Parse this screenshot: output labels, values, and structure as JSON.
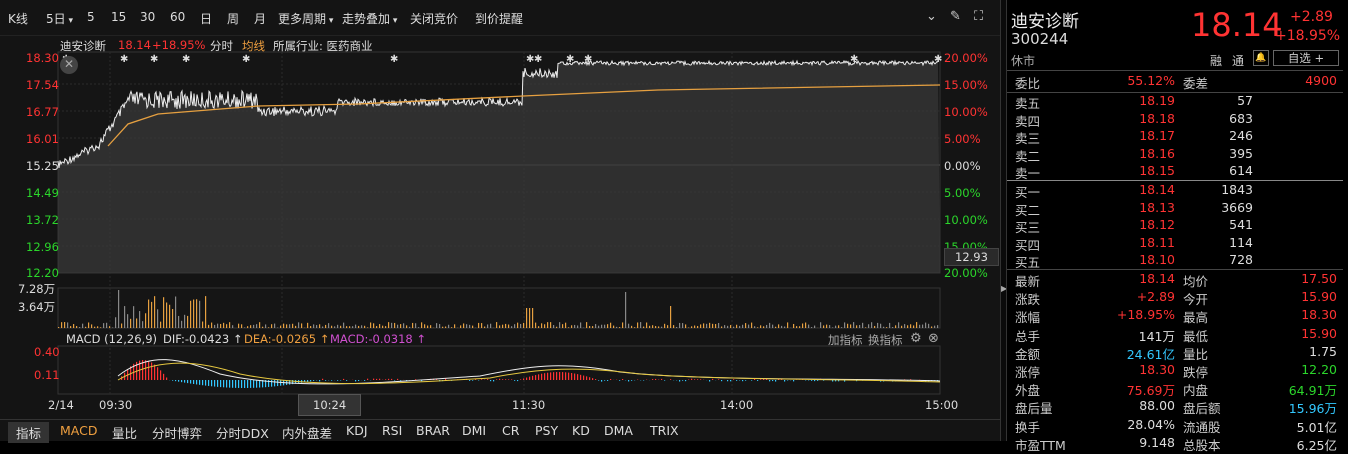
{
  "toolbar": {
    "items": [
      "K线",
      "5日",
      "5",
      "15",
      "30",
      "60",
      "日",
      "周",
      "月",
      "更多周期",
      "走势叠加",
      "关闭竞价",
      "到价提醒"
    ]
  },
  "chart_header": {
    "name": "迪安诊断",
    "price": "18.14",
    "pct": "+18.95%",
    "tab_fenshi": "分时",
    "tab_junxian": "均线",
    "industry": "所属行业: 医药商业"
  },
  "price_axis": {
    "left": [
      "18.30",
      "17.54",
      "16.77",
      "16.01",
      "15.25",
      "14.49",
      "13.72",
      "12.96",
      "12.20"
    ],
    "right": [
      "20.00%",
      "15.00%",
      "10.00%",
      "5.00%",
      "0.00%",
      "5.00%",
      "10.00%",
      "15.00%",
      "20.00%"
    ],
    "cursor_label": "12.93"
  },
  "volume_axis": {
    "labels": [
      "7.28万",
      "3.64万"
    ]
  },
  "macd": {
    "name": "MACD (12,26,9)",
    "dif": "DIF:-0.0423",
    "dea": "DEA:-0.0265",
    "macd": "MACD:-0.0318",
    "add_indicator": "加指标",
    "change_indicator": "换指标",
    "axis": [
      "0.40",
      "0.11"
    ]
  },
  "time_axis": {
    "date": "2/14",
    "labels": [
      "09:30",
      "10:24",
      "11:30",
      "14:00",
      "15:00"
    ]
  },
  "bottom_tabs": [
    "指标",
    "MACD",
    "量比",
    "分时博弈",
    "分时DDX",
    "内外盘差",
    "KDJ",
    "RSI",
    "BRAR",
    "DMI",
    "CR",
    "PSY",
    "KD",
    "DMA",
    "TRIX"
  ],
  "quote": {
    "name": "迪安诊断",
    "code": "300244",
    "status": "休市",
    "price": "18.14",
    "change": "+2.89",
    "pct": "+18.95%",
    "tag1": "融",
    "tag2": "通",
    "bell": "🔔",
    "watch": "自选 +",
    "weibi_label": "委比",
    "weibi": "55.12%",
    "weicha_label": "委差",
    "weicha": "4900",
    "sells": [
      {
        "label": "卖五",
        "price": "18.19",
        "vol": "57"
      },
      {
        "label": "卖四",
        "price": "18.18",
        "vol": "683"
      },
      {
        "label": "卖三",
        "price": "18.17",
        "vol": "246"
      },
      {
        "label": "卖二",
        "price": "18.16",
        "vol": "395"
      },
      {
        "label": "卖一",
        "price": "18.15",
        "vol": "614"
      }
    ],
    "buys": [
      {
        "label": "买一",
        "price": "18.14",
        "vol": "1843"
      },
      {
        "label": "买二",
        "price": "18.13",
        "vol": "3669"
      },
      {
        "label": "买三",
        "price": "18.12",
        "vol": "541"
      },
      {
        "label": "买四",
        "price": "18.11",
        "vol": "114"
      },
      {
        "label": "买五",
        "price": "18.10",
        "vol": "728"
      }
    ],
    "stats": [
      {
        "l1": "最新",
        "v1": "18.14",
        "c1": "red",
        "l2": "均价",
        "v2": "17.50",
        "c2": "red"
      },
      {
        "l1": "涨跌",
        "v1": "+2.89",
        "c1": "red",
        "l2": "今开",
        "v2": "15.90",
        "c2": "red"
      },
      {
        "l1": "涨幅",
        "v1": "+18.95%",
        "c1": "red",
        "l2": "最高",
        "v2": "18.30",
        "c2": "red"
      },
      {
        "l1": "总手",
        "v1": "141万",
        "c1": "white",
        "l2": "最低",
        "v2": "15.90",
        "c2": "red"
      },
      {
        "l1": "金额",
        "v1": "24.61亿",
        "c1": "cyan",
        "l2": "量比",
        "v2": "1.75",
        "c2": "white"
      },
      {
        "l1": "涨停",
        "v1": "18.30",
        "c1": "red",
        "l2": "跌停",
        "v2": "12.20",
        "c2": "green"
      },
      {
        "l1": "外盘",
        "v1": "75.69万",
        "c1": "red",
        "l2": "内盘",
        "v2": "64.91万",
        "c2": "green"
      },
      {
        "l1": "盘后量",
        "v1": "88.00",
        "c1": "white",
        "l2": "盘后额",
        "v2": "15.96万",
        "c2": "cyan"
      },
      {
        "l1": "换手",
        "v1": "28.04%",
        "c1": "white",
        "l2": "流通股",
        "v2": "5.01亿",
        "c2": "white"
      },
      {
        "l1": "市盈TTM",
        "v1": "9.148",
        "c1": "white",
        "l2": "总股本",
        "v2": "6.25亿",
        "c2": "white"
      }
    ]
  },
  "colors": {
    "up": "#ff3333",
    "down": "#2bd62b",
    "avg": "#e6a040",
    "cyan": "#33c8ff"
  }
}
